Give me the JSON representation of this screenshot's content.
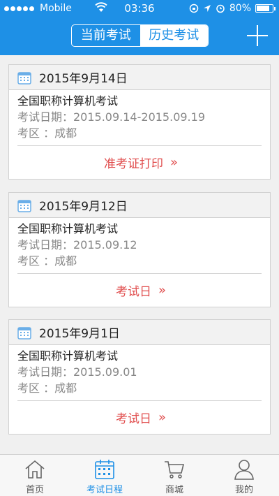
{
  "status_bar": {
    "carrier": "Mobile",
    "time": "03:36",
    "battery": "80%",
    "battery_level": 0.8
  },
  "header": {
    "segments": [
      "当前考试",
      "历史考试"
    ],
    "active_segment": 1
  },
  "cards": [
    {
      "date": "2015年9月14日",
      "name": "全国职称计算机考试",
      "exam_date": "考试日期：2015.09.14-2015.09.19",
      "area": "考区 ：成都",
      "action": "准考证打印"
    },
    {
      "date": "2015年9月12日",
      "name": "全国职称计算机考试",
      "exam_date": "考试日期：2015.09.12",
      "area": "考区 ：成都",
      "action": "考试日"
    },
    {
      "date": "2015年9月1日",
      "name": "全国职称计算机考试",
      "exam_date": "考试日期：2015.09.01",
      "area": "考区 ：成都",
      "action": "考试日"
    }
  ],
  "action_chevron": "»",
  "tabbar": {
    "items": [
      {
        "label": "首页",
        "icon": "home-icon"
      },
      {
        "label": "考试日程",
        "icon": "calendar-icon"
      },
      {
        "label": "商城",
        "icon": "cart-icon"
      },
      {
        "label": "我的",
        "icon": "person-icon"
      }
    ],
    "active": 1
  },
  "colors": {
    "accent": "#1e90e6",
    "action": "#e04b4b"
  }
}
